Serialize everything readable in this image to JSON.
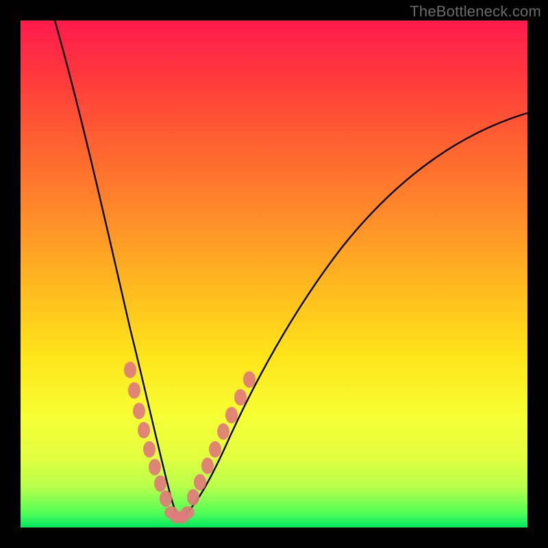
{
  "watermark": "TheBottleneck.com",
  "chart_data": {
    "type": "line",
    "title": "",
    "xlabel": "",
    "ylabel": "",
    "xlim": [
      0,
      100
    ],
    "ylim": [
      0,
      100
    ],
    "background_gradient": {
      "orientation": "vertical",
      "stops": [
        {
          "pos": 0,
          "color": "#ff1a4d"
        },
        {
          "pos": 12,
          "color": "#ff3b3b"
        },
        {
          "pos": 25,
          "color": "#ff6430"
        },
        {
          "pos": 38,
          "color": "#ff8a2a"
        },
        {
          "pos": 52,
          "color": "#ffb81f"
        },
        {
          "pos": 66,
          "color": "#ffe41a"
        },
        {
          "pos": 78,
          "color": "#f6ff33"
        },
        {
          "pos": 86,
          "color": "#e3ff3f"
        },
        {
          "pos": 92,
          "color": "#b8ff4b"
        },
        {
          "pos": 97,
          "color": "#55ff55"
        },
        {
          "pos": 100,
          "color": "#00e860"
        }
      ]
    },
    "series": [
      {
        "name": "left-curve",
        "stroke": "#000000",
        "values": [
          {
            "x": 7,
            "y": 100
          },
          {
            "x": 10,
            "y": 85
          },
          {
            "x": 13,
            "y": 70
          },
          {
            "x": 16,
            "y": 55
          },
          {
            "x": 19,
            "y": 40
          },
          {
            "x": 21,
            "y": 30
          },
          {
            "x": 23,
            "y": 20
          },
          {
            "x": 25,
            "y": 12
          },
          {
            "x": 27,
            "y": 6
          },
          {
            "x": 29,
            "y": 3
          },
          {
            "x": 31,
            "y": 2
          }
        ]
      },
      {
        "name": "right-curve",
        "stroke": "#000000",
        "values": [
          {
            "x": 31,
            "y": 2
          },
          {
            "x": 34,
            "y": 6
          },
          {
            "x": 38,
            "y": 14
          },
          {
            "x": 44,
            "y": 26
          },
          {
            "x": 52,
            "y": 40
          },
          {
            "x": 62,
            "y": 54
          },
          {
            "x": 74,
            "y": 66
          },
          {
            "x": 88,
            "y": 76
          },
          {
            "x": 100,
            "y": 82
          }
        ]
      }
    ],
    "markers": {
      "color": "#e07a7a",
      "radius_approx": 1.2,
      "points_left_branch": [
        {
          "x": 21.5,
          "y": 31
        },
        {
          "x": 22.3,
          "y": 27
        },
        {
          "x": 23.2,
          "y": 23
        },
        {
          "x": 24.0,
          "y": 19
        },
        {
          "x": 25.0,
          "y": 15
        },
        {
          "x": 26.2,
          "y": 11
        },
        {
          "x": 27.4,
          "y": 8
        },
        {
          "x": 28.6,
          "y": 5
        }
      ],
      "points_right_branch": [
        {
          "x": 33.5,
          "y": 6
        },
        {
          "x": 35.0,
          "y": 9
        },
        {
          "x": 36.5,
          "y": 12
        },
        {
          "x": 38.0,
          "y": 15
        },
        {
          "x": 39.6,
          "y": 18
        },
        {
          "x": 41.0,
          "y": 21
        },
        {
          "x": 43.0,
          "y": 25
        },
        {
          "x": 45.0,
          "y": 29
        }
      ],
      "points_bottom": [
        {
          "x": 29.5,
          "y": 2.2
        },
        {
          "x": 30.5,
          "y": 2.0
        },
        {
          "x": 31.5,
          "y": 2.0
        },
        {
          "x": 32.5,
          "y": 2.4
        }
      ]
    }
  }
}
